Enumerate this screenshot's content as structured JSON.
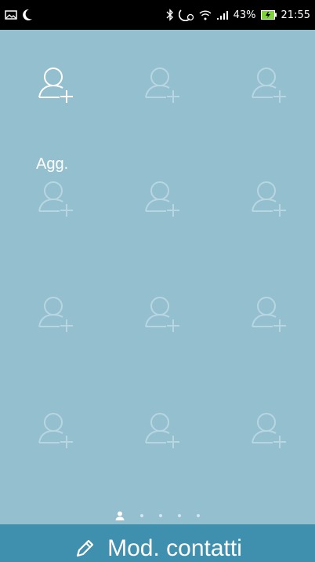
{
  "statusbar": {
    "left_icons": [
      "image-icon",
      "moon-icon"
    ],
    "right_icons": [
      "bluetooth-icon",
      "do-not-disturb-icon",
      "wifi-icon",
      "signal-icon",
      "battery-icon"
    ],
    "battery_percent": "43%",
    "time": "21:55"
  },
  "grid": {
    "cells": [
      {
        "name": "contact-slot-1",
        "label": "Agg.",
        "active": true
      },
      {
        "name": "contact-slot-2",
        "label": "",
        "active": false
      },
      {
        "name": "contact-slot-3",
        "label": "",
        "active": false
      },
      {
        "name": "contact-slot-4",
        "label": "",
        "active": false
      },
      {
        "name": "contact-slot-5",
        "label": "",
        "active": false
      },
      {
        "name": "contact-slot-6",
        "label": "",
        "active": false
      },
      {
        "name": "contact-slot-7",
        "label": "",
        "active": false
      },
      {
        "name": "contact-slot-8",
        "label": "",
        "active": false
      },
      {
        "name": "contact-slot-9",
        "label": "",
        "active": false
      },
      {
        "name": "contact-slot-10",
        "label": "",
        "active": false
      },
      {
        "name": "contact-slot-11",
        "label": "",
        "active": false
      },
      {
        "name": "contact-slot-12",
        "label": "",
        "active": false
      }
    ]
  },
  "pager": {
    "pages": 5,
    "current": 1
  },
  "bottom_bar": {
    "label": "Mod. contatti",
    "icon": "pencil-icon"
  },
  "colors": {
    "background": "#94bfcf",
    "bottom_bar": "#3f8fae",
    "icon_active": "#ffffff",
    "icon_inactive": "#b8d6e1"
  }
}
